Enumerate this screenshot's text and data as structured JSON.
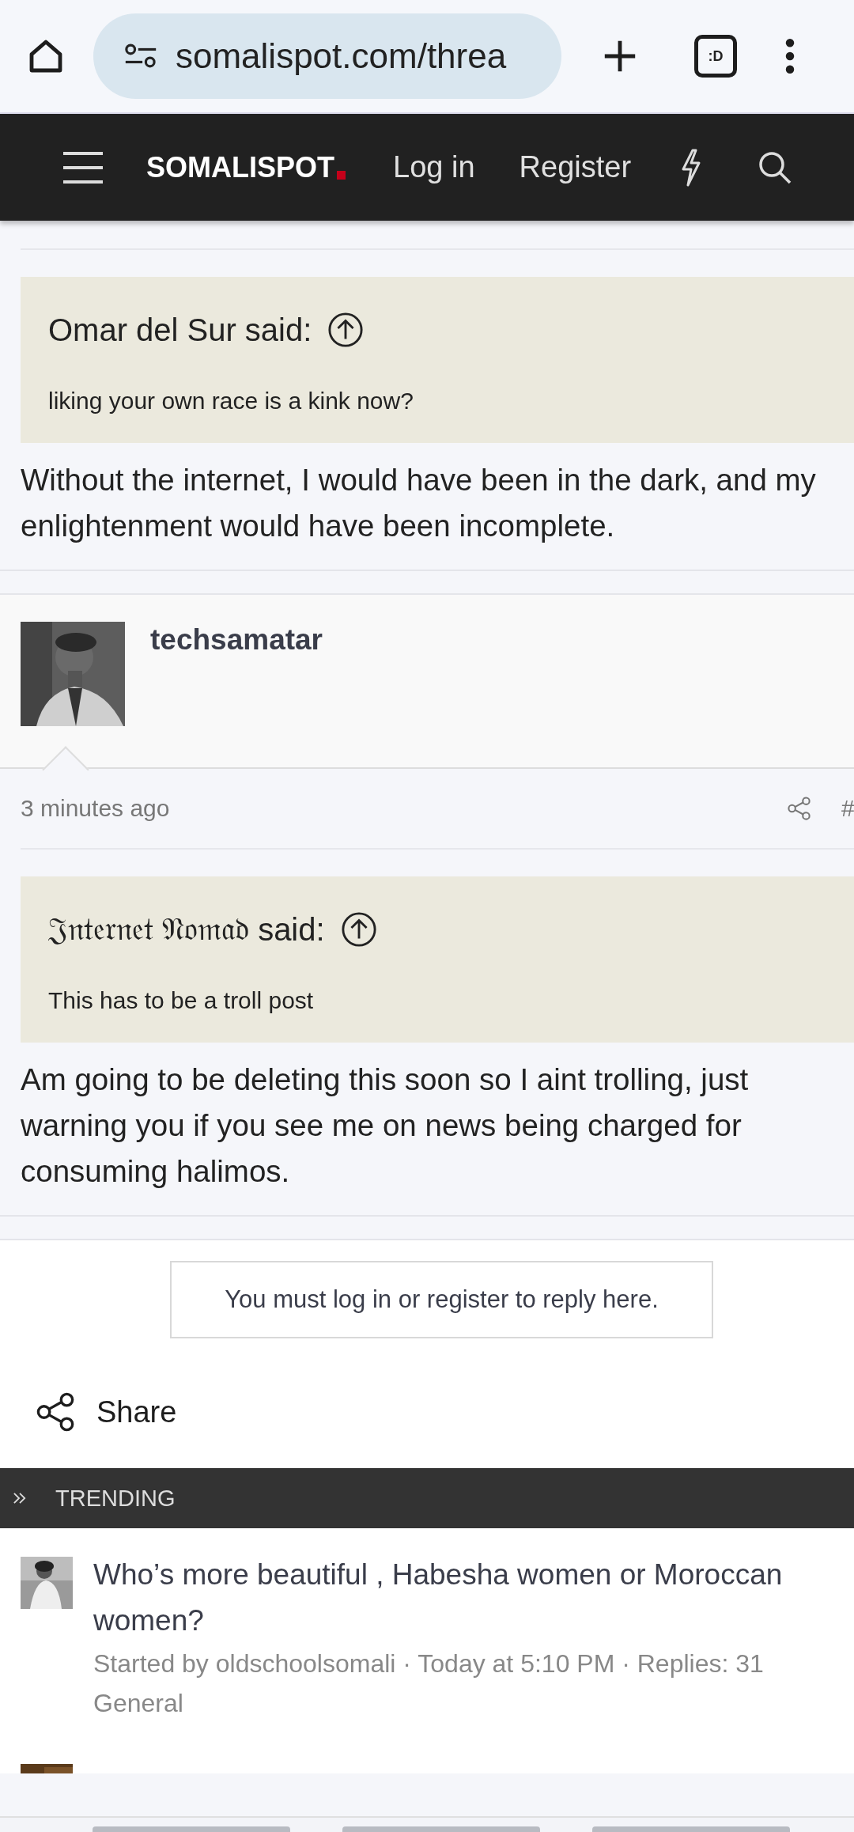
{
  "browser": {
    "url": "somalispot.com/threa",
    "tab_icon": ":D"
  },
  "nav": {
    "logo": "SOMALISPOT",
    "links": [
      "Log in",
      "Register"
    ]
  },
  "posts": [
    {
      "quote": {
        "author": "Omar del Sur",
        "said": "said:",
        "text": "liking your own race is a kink now?"
      },
      "body": [
        "Without the internet, I would have been in the dark, and my",
        "enlightenment would have been incomplete."
      ]
    },
    {
      "author": "techsamatar",
      "time": "3 minutes ago",
      "permalink": "#",
      "quote": {
        "author": "𝔍𝔫𝔱𝔢𝔯𝔫𝔢𝔱 𝔑𝔬𝔪𝔞𝔡",
        "said": "said:",
        "text": "This has to be a troll post"
      },
      "body": [
        "Am going to be deleting this soon so I aint trolling, just warning you if you see me on news being charged for consuming halimos."
      ]
    }
  ],
  "notice": "You must log in or register to reply here.",
  "share": "Share",
  "trending": {
    "title": "TRENDING",
    "items": [
      {
        "title": "Who’s more beautiful , Habesha women or Moroccan women?",
        "meta": "Started by oldschoolsomali · Today at 5:10 PM · Replies: 31",
        "forum": "General"
      }
    ]
  }
}
